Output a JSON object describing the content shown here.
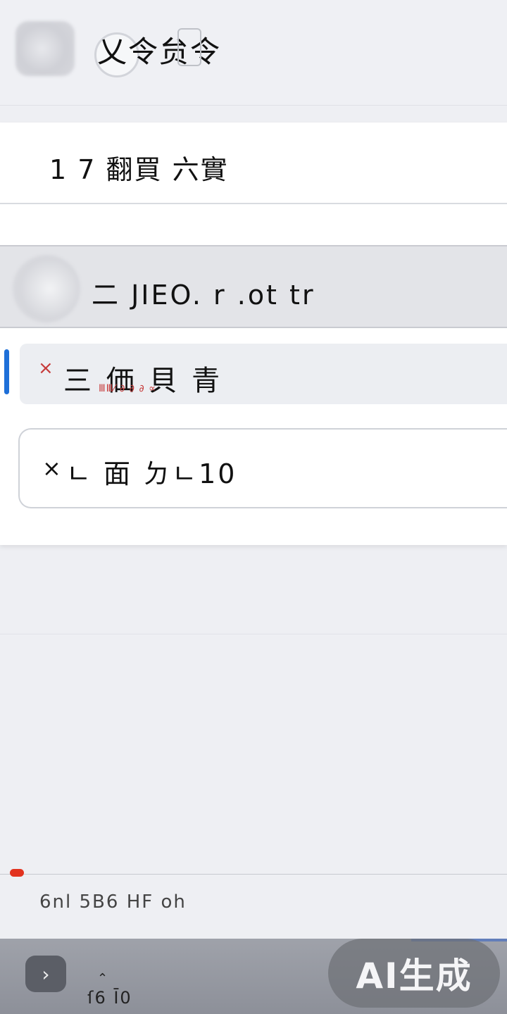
{
  "header": {
    "title": "乂令贠令"
  },
  "menu": {
    "item1": {
      "label": "1 7 翻買 六實"
    },
    "item2": {
      "label": "二 JIEO. r .ot tr"
    },
    "item3": {
      "close_glyph": "×",
      "label": "三 価 貝 青",
      "sublabel": "ⅢⅢ⁄ ∂ ∂ ∂ ∝"
    },
    "item4": {
      "close_glyph": "×",
      "label": "ㄴ 面 ㄉㄴ10"
    }
  },
  "status": {
    "text": "6nl 5B6 HF oh"
  },
  "bottom_bar": {
    "nav_glyph": "›",
    "caption": "ſ6 Ī0",
    "ai_label": "AI生成"
  },
  "colors": {
    "accent_blue": "#1e6fd8",
    "close_red": "#c63a3a",
    "dot_red": "#e2331f"
  }
}
